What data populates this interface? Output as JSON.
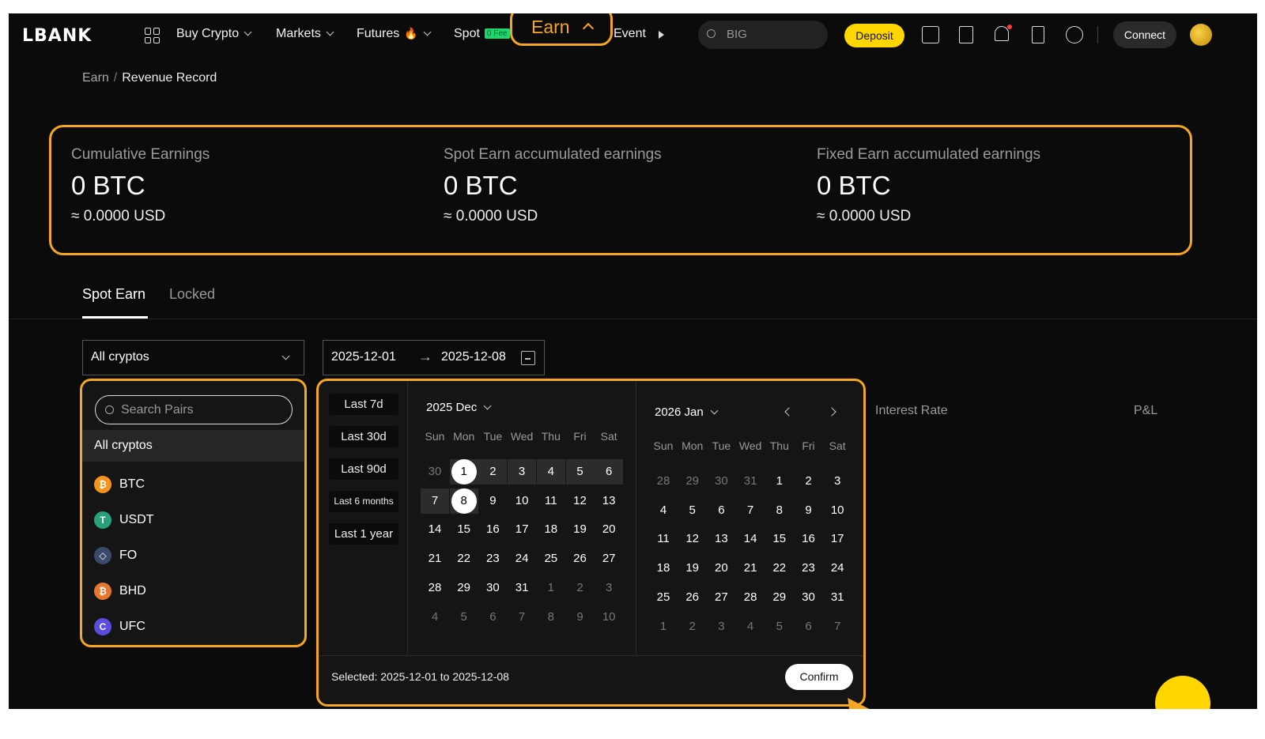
{
  "nav": {
    "logo": "LBANK",
    "items": [
      "Buy Crypto",
      "Markets",
      "Futures",
      "Spot"
    ],
    "spot_badge": "0 Fee",
    "earn": "Earn",
    "events": "Event",
    "search_placeholder": "BIG",
    "deposit": "Deposit",
    "connect": "Connect"
  },
  "breadcrumb": {
    "parent": "Earn",
    "sep": "/",
    "current": "Revenue Record"
  },
  "stats": [
    {
      "label": "Cumulative Earnings",
      "value": "0 BTC",
      "usd": "≈ 0.0000 USD"
    },
    {
      "label": "Spot Earn accumulated earnings",
      "value": "0 BTC",
      "usd": "≈ 0.0000 USD"
    },
    {
      "label": "Fixed Earn accumulated earnings",
      "value": "0 BTC",
      "usd": "≈ 0.0000 USD"
    }
  ],
  "tabs": {
    "spot": "Spot Earn",
    "locked": "Locked"
  },
  "filters": {
    "crypto_value": "All cryptos",
    "date_from": "2025-12-01",
    "date_to": "2025-12-08",
    "arrow": "→"
  },
  "crypto_dropdown": {
    "search_placeholder": "Search Pairs",
    "all": "All cryptos",
    "coins": [
      {
        "name": "BTC",
        "symbol": "₿",
        "color": "#f7931a"
      },
      {
        "name": "USDT",
        "symbol": "T",
        "color": "#26a17b"
      },
      {
        "name": "FO",
        "symbol": "◇",
        "color": "#3a4a6b"
      },
      {
        "name": "BHD",
        "symbol": "₿",
        "color": "#e8772e"
      },
      {
        "name": "UFC",
        "symbol": "C",
        "color": "#5b4ce0"
      }
    ]
  },
  "calendar": {
    "quick": [
      "Last 7d",
      "Last 30d",
      "Last 90d",
      "Last 6 months",
      "Last 1 year"
    ],
    "weekdays": [
      "Sun",
      "Mon",
      "Tue",
      "Wed",
      "Thu",
      "Fri",
      "Sat"
    ],
    "left_title": "2025 Dec",
    "right_title": "2026 Jan",
    "left_days": [
      "30",
      "1",
      "2",
      "3",
      "4",
      "5",
      "6",
      "7",
      "8",
      "9",
      "10",
      "11",
      "12",
      "13",
      "14",
      "15",
      "16",
      "17",
      "18",
      "19",
      "20",
      "21",
      "22",
      "23",
      "24",
      "25",
      "26",
      "27",
      "28",
      "29",
      "30",
      "31",
      "1",
      "2",
      "3",
      "4",
      "5",
      "6",
      "7",
      "8",
      "9",
      "10"
    ],
    "right_days": [
      "28",
      "29",
      "30",
      "31",
      "1",
      "2",
      "3",
      "4",
      "5",
      "6",
      "7",
      "8",
      "9",
      "10",
      "11",
      "12",
      "13",
      "14",
      "15",
      "16",
      "17",
      "18",
      "19",
      "20",
      "21",
      "22",
      "23",
      "24",
      "25",
      "26",
      "27",
      "28",
      "29",
      "30",
      "31",
      "1",
      "2",
      "3",
      "4",
      "5",
      "6",
      "7"
    ],
    "selected_text": "Selected: 2025-12-01 to 2025-12-08",
    "confirm": "Confirm"
  },
  "columns": {
    "interest": "Interest Rate",
    "pnl": "P&L"
  },
  "colors": {
    "accent": "#f5a623",
    "deposit": "#ffd600",
    "background": "#0b0b0b"
  }
}
